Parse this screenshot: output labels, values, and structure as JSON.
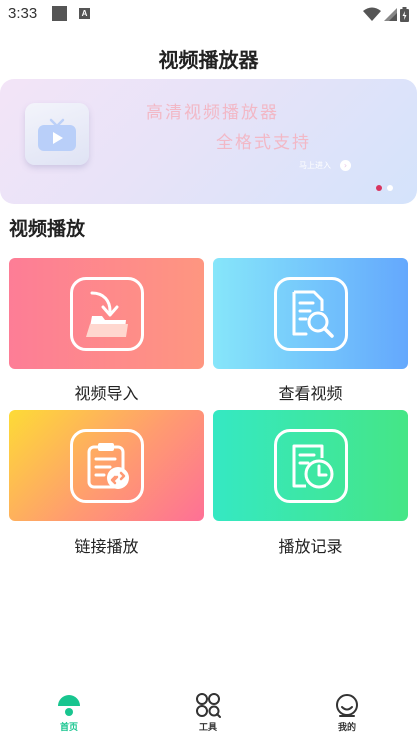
{
  "status_bar": {
    "time": "3:33"
  },
  "header": {
    "title": "视频播放器"
  },
  "banner": {
    "line1": "高清视频播放器",
    "line2": "全格式支持",
    "enter_label": "马上进入",
    "slide_count": 2,
    "active_slide": 1
  },
  "section": {
    "title": "视频播放"
  },
  "tiles": [
    {
      "label": "视频导入",
      "icon": "import-folder-icon"
    },
    {
      "label": "查看视频",
      "icon": "search-document-icon"
    },
    {
      "label": "链接播放",
      "icon": "clipboard-link-icon"
    },
    {
      "label": "播放记录",
      "icon": "history-clock-icon"
    }
  ],
  "nav": {
    "items": [
      {
        "label": "首页",
        "icon": "home-icon",
        "active": true
      },
      {
        "label": "工具",
        "icon": "tools-icon",
        "active": false
      },
      {
        "label": "我的",
        "icon": "profile-icon",
        "active": false
      }
    ],
    "accent_color": "#18c58f"
  }
}
